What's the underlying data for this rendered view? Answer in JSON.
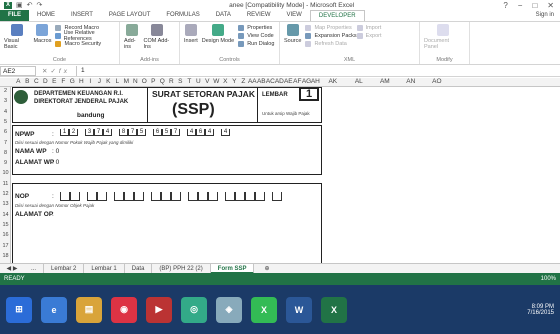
{
  "window": {
    "title": "anee  [Compatibility Mode] - Microsoft Excel",
    "controls": [
      "?",
      "−",
      "□",
      "✕"
    ]
  },
  "ribbon_tabs": [
    "FILE",
    "HOME",
    "INSERT",
    "PAGE LAYOUT",
    "FORMULAS",
    "DATA",
    "REVIEW",
    "VIEW",
    "DEVELOPER"
  ],
  "signin": "Sign in",
  "ribbon": {
    "code": {
      "label": "Code",
      "visual_basic": "Visual Basic",
      "macros": "Macros",
      "record_macro": "Record Macro",
      "relative_refs": "Use Relative References",
      "macro_security": "Macro Security"
    },
    "addins": {
      "label": "Add-ins",
      "addins": "Add-ins",
      "com_addins": "COM Add-Ins"
    },
    "controls": {
      "label": "Controls",
      "insert": "Insert",
      "design_mode": "Design Mode",
      "properties": "Properties",
      "view_code": "View Code",
      "run_dialog": "Run Dialog"
    },
    "xml": {
      "label": "XML",
      "source": "Source",
      "map_properties": "Map Properties",
      "expansion_packs": "Expansion Packs",
      "refresh_data": "Refresh Data",
      "import": "Import",
      "export": "Export"
    },
    "modify": {
      "label": "Modify",
      "document_panel": "Document Panel"
    }
  },
  "formula_bar": {
    "name_box": "AE2",
    "fx": "fx",
    "value": "1"
  },
  "columns": [
    "A",
    "B",
    "C",
    "D",
    "E",
    "F",
    "G",
    "H",
    "I",
    "J",
    "K",
    "L",
    "M",
    "N",
    "O",
    "P",
    "Q",
    "R",
    "S",
    "T",
    "U",
    "V",
    "W",
    "X",
    "Y",
    "Z",
    "AA",
    "AB",
    "AC",
    "AD",
    "AE",
    "AF",
    "AG",
    "AH",
    "AK",
    "AL",
    "AM",
    "AN",
    "AO"
  ],
  "rows": [
    "2",
    "3",
    "4",
    "5",
    "6",
    "7",
    "8",
    "9",
    "10",
    "11",
    "12",
    "13",
    "14",
    "15",
    "16",
    "17",
    "18"
  ],
  "form": {
    "dept1": "DEPARTEMEN KEUANGAN R.I.",
    "dept2": "DIREKTORAT JENDERAL PAJAK",
    "city": "bandung",
    "title": "SURAT SETORAN PAJAK",
    "abbr": "(SSP)",
    "lembar_label": "LEMBAR",
    "lembar_value": "1",
    "lembar_note": "Untuk arsip Wajib Pajak",
    "npwp_label": "NPWP",
    "npwp_colon": ":",
    "npwp_groups": [
      "1",
      "2",
      "3",
      "7",
      "4",
      "8",
      "7",
      "5",
      "6",
      "5",
      "7",
      "4",
      "6",
      "4",
      "4"
    ],
    "npwp_note": "Diisi sesuai dengan Nomor Pokok Wajib Pajak yang dimiliki",
    "nama_label": "NAMA WP",
    "nama_value": ":   0",
    "alamat_label": "ALAMAT WP",
    "alamat_value": ":   0",
    "nop_label": "NOP",
    "nop_colon": ":",
    "nop_note": "Diisi sesuai dengan Nomor Objek Pajak",
    "alamat_op_label": "ALAMAT OP",
    "alamat_op_colon": ":"
  },
  "sheet_tabs": [
    "...",
    "Lembar 2",
    "Lembar 1",
    "Data",
    "(BP) PPH 22 (2)",
    "Form SSP"
  ],
  "active_sheet": "Form SSP",
  "status": {
    "ready": "READY",
    "zoom": "100%"
  },
  "taskbar": {
    "time": "8:09 PM",
    "date": "7/16/2015"
  }
}
